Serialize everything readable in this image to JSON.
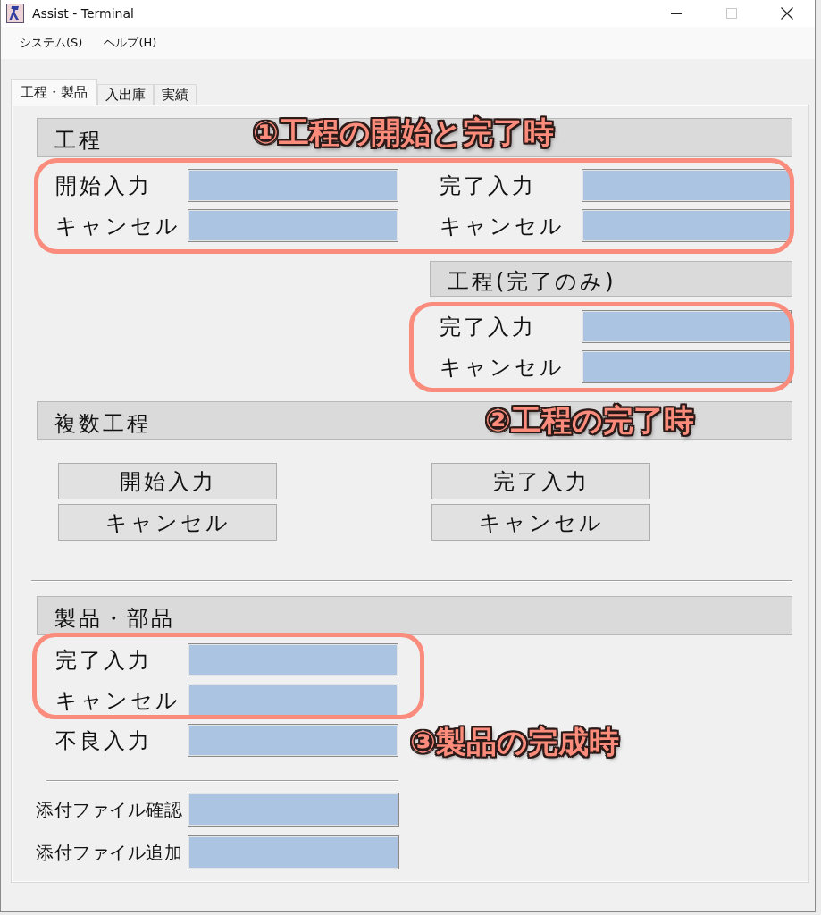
{
  "window": {
    "title": "Assist - Terminal",
    "controls": [
      {
        "kind": "minimize",
        "disabled": false
      },
      {
        "kind": "maximize",
        "disabled": true
      },
      {
        "kind": "close",
        "disabled": false
      }
    ]
  },
  "menu": [
    "システム(S)",
    "ヘルプ(H)"
  ],
  "tabs": [
    {
      "label": "工程・製品",
      "selected": true
    },
    {
      "label": "入出庫",
      "selected": false
    },
    {
      "label": "実績",
      "selected": false
    }
  ],
  "process": {
    "title": "工程",
    "left_fields": [
      "開始入力",
      "キャンセル"
    ],
    "right_fields": [
      "完了入力",
      "キャンセル"
    ]
  },
  "process_complete_only": {
    "title": "工程(完了のみ)",
    "fields": [
      "完了入力",
      "キャンセル"
    ]
  },
  "multiple_processes": {
    "title": "複数工程",
    "left_buttons": [
      "開始入力",
      "キャンセル"
    ],
    "right_buttons": [
      "完了入力",
      "キャンセル"
    ]
  },
  "products_parts": {
    "title": "製品・部品",
    "fields": [
      "完了入力",
      "キャンセル",
      "不良入力"
    ]
  },
  "attachments": {
    "fields": [
      "添付ファイル確認",
      "添付ファイル追加"
    ]
  },
  "annotations": [
    {
      "text": "①工程の開始と完了時"
    },
    {
      "text": "②工程の完了時"
    },
    {
      "text": "③製品の完成時"
    }
  ]
}
